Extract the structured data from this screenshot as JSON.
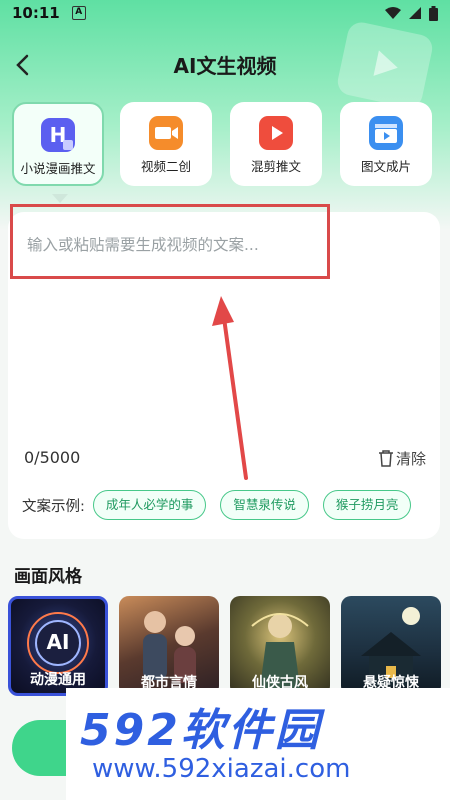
{
  "status": {
    "time": "10:11",
    "a_glyph": "A"
  },
  "header": {
    "title": "AI文生视频",
    "back_glyph": "<"
  },
  "mode_cards": [
    {
      "label": "小说漫画推文",
      "icon": "h-doc-icon",
      "color": "#5b5ff0"
    },
    {
      "label": "视频二创",
      "icon": "video-camera-icon",
      "color": "#f58c2b"
    },
    {
      "label": "混剪推文",
      "icon": "video-play-icon",
      "color": "#ef4d3d"
    },
    {
      "label": "图文成片",
      "icon": "clapperboard-icon",
      "color": "#3b8ff0"
    }
  ],
  "editor": {
    "placeholder": "输入或粘贴需要生成视频的文案...",
    "counter": "0/5000",
    "clear_label": "清除"
  },
  "examples": {
    "label": "文案示例:",
    "chips": [
      "成年人必学的事",
      "智慧泉传说",
      "猴子捞月亮"
    ]
  },
  "style_section": {
    "title": "画面风格",
    "items": [
      {
        "label": "动漫通用"
      },
      {
        "label": "都市言情"
      },
      {
        "label": "仙侠古风"
      },
      {
        "label": "悬疑惊悚"
      }
    ],
    "first_badge": "AI"
  },
  "watermark": {
    "brand": "592软件园",
    "url": "www.592xiazai.com"
  },
  "colors": {
    "accent": "#3fd58b",
    "highlight": "#d94a4a",
    "chip_border": "#48c88a"
  }
}
